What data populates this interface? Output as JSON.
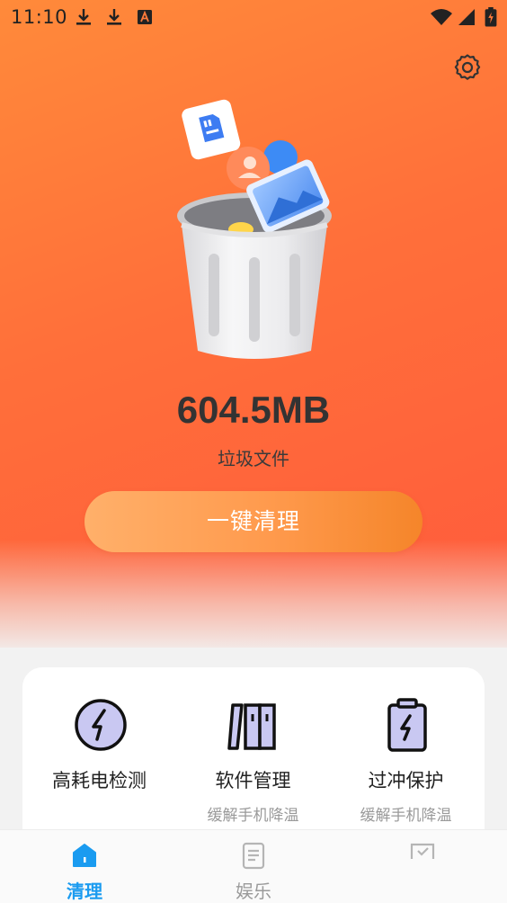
{
  "status_bar": {
    "time": "11:10"
  },
  "icons": {
    "settings": "gear-icon",
    "download": "download-icon",
    "app_badge": "a-letter-icon",
    "wifi": "wifi-icon",
    "signal": "signal-icon",
    "battery": "battery-charging-icon",
    "illustration": "trash-can-illustration"
  },
  "cleaner": {
    "size": "604.5MB",
    "caption": "垃圾文件",
    "clean_button": "一键清理"
  },
  "features": [
    {
      "title": "高耗电检测",
      "subtitle": "",
      "icon": "lightning-circle-icon"
    },
    {
      "title": "软件管理",
      "subtitle": "缓解手机降温",
      "icon": "books-icon"
    },
    {
      "title": "过冲保护",
      "subtitle": "缓解手机降温",
      "icon": "battery-clipboard-icon"
    }
  ],
  "bottom_nav": [
    {
      "label": "清理",
      "active": true,
      "icon": "home-icon"
    },
    {
      "label": "娱乐",
      "active": false,
      "icon": "document-icon"
    },
    {
      "label": "",
      "active": false,
      "icon": "check-box-icon"
    }
  ],
  "colors": {
    "hero_start": "#ff8a3a",
    "hero_end": "#ff5a3c",
    "active_nav": "#1a9bf0",
    "feature_icon_fill": "#c9c8f2"
  }
}
